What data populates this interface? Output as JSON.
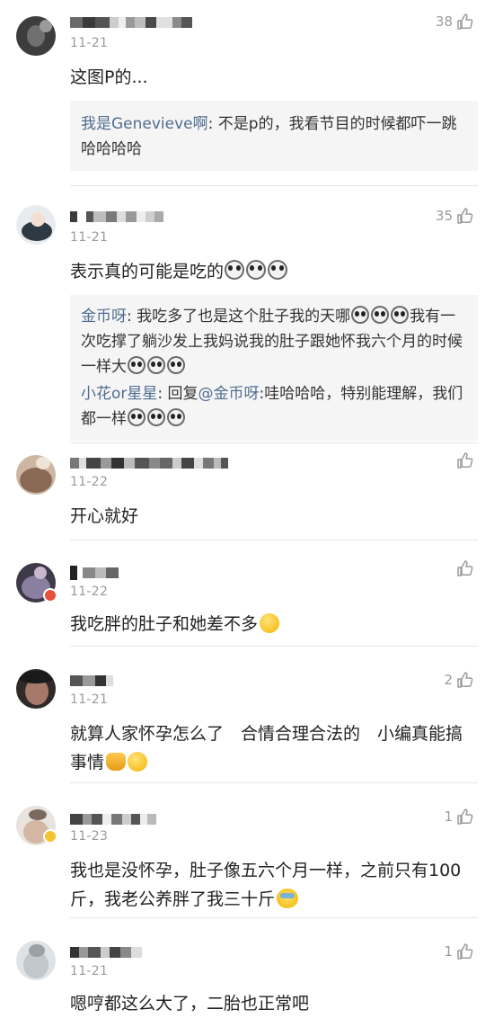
{
  "comments": [
    {
      "date": "11-21",
      "likes": "38",
      "text": "这图P的...",
      "replies": [
        {
          "name": "我是Genevieve啊",
          "text": ": 不是p的，我看节目的时候都吓一跳哈哈哈哈"
        }
      ]
    },
    {
      "date": "11-21",
      "likes": "35",
      "text": "表示真的可能是吃的",
      "replies": [
        {
          "name": "金币呀",
          "text_a": ": 我吃多了也是这个肚子我的天哪",
          "text_b": "我有一次吃撑了躺沙发上我妈说我的肚子跟她怀我六个月的时候一样大"
        },
        {
          "name": "小花or星星",
          "text_a": ": 回复",
          "mention": "@金币呀",
          "text_b": ":哇哈哈哈，特别能理解，我们都一样"
        }
      ]
    },
    {
      "date": "11-22",
      "likes": "",
      "text": "开心就好"
    },
    {
      "date": "11-22",
      "likes": "",
      "text": "我吃胖的肚子和她差不多"
    },
    {
      "date": "11-21",
      "likes": "2",
      "text": "就算人家怀孕怎么了　合情合理合法的　小编真能搞事情"
    },
    {
      "date": "11-23",
      "likes": "1",
      "text": "我也是没怀孕，肚子像五六个月一样，之前只有100斤，我老公养胖了我三十斤"
    },
    {
      "date": "11-21",
      "likes": "1",
      "text": "嗯哼都这么大了，二胎也正常吧"
    }
  ],
  "colors": {
    "accent_name": "#4f6d8f",
    "reply_bg": "#f5f5f5",
    "meta_gray": "#9a9a9a"
  },
  "icons": {
    "like": "thumbs-up-icon",
    "emoji": "dog-face-emoji"
  }
}
